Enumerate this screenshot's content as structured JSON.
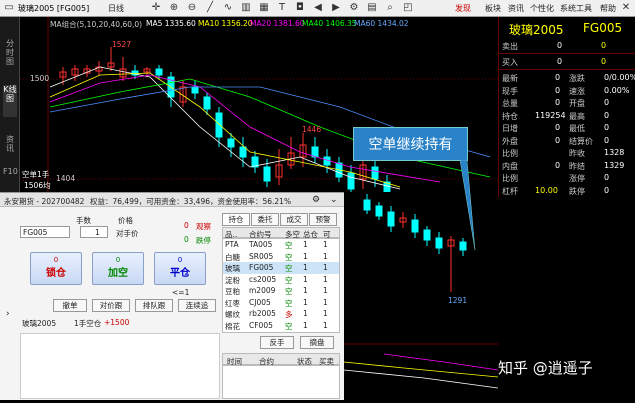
{
  "topbar": {
    "symbol": "玻璃2005 [FG005]",
    "period": "日线",
    "menu": [
      "发现",
      "板块",
      "资讯",
      "个性化",
      "系统工具",
      "帮助"
    ]
  },
  "lefttabs": [
    "分时图",
    "K线图",
    "资讯",
    "F10"
  ],
  "chart": {
    "ma_legend": {
      "title": "MA组合(5,10,20,40,60,0)",
      "ma5": "MA5 1335.60",
      "ma10": "MA10 1356.20",
      "ma20": "MA20 1381.60",
      "ma40": "MA40 1406.35",
      "ma60": "MA60 1434.02"
    },
    "high_label": "1527",
    "mid_label": "1446",
    "low_label": "1291",
    "axis_1500": "1500",
    "cross_price": "1404",
    "position_label": "空单1手",
    "position_price": "1506均",
    "colors": {
      "ma5": "#ffffff",
      "ma10": "#ffff00",
      "ma20": "#ff00ff",
      "ma40": "#00ff00",
      "ma60": "#4a90ff",
      "up": "#ff3030",
      "down": "#00ffff"
    }
  },
  "callout": "空单继续持有",
  "watermark": "知乎 @逍遥子",
  "quote": {
    "name": "玻璃2005",
    "code": "FG005",
    "sell": {
      "label": "卖出",
      "v1": "0",
      "v2": "0"
    },
    "buy": {
      "label": "买入",
      "v1": "0",
      "v2": "0"
    },
    "rows": [
      {
        "l1": "最新",
        "v1": "0",
        "l2": "涨跌",
        "v2": "0/0.00%"
      },
      {
        "l1": "现手",
        "v1": "0",
        "l2": "速涨",
        "v2": "0.00%"
      },
      {
        "l1": "总量",
        "v1": "0",
        "l2": "开盘",
        "v2": "0"
      },
      {
        "l1": "持仓",
        "v1": "119254",
        "l2": "最高",
        "v2": "0"
      },
      {
        "l1": "日增",
        "v1": "0",
        "l2": "最低",
        "v2": "0"
      },
      {
        "l1": "外盘",
        "v1": "0",
        "l2": "结算价",
        "v2": "0"
      },
      {
        "l1": "比例",
        "v1": "",
        "l2": "昨收",
        "v2": "1328"
      },
      {
        "l1": "内盘",
        "v1": "0",
        "l2": "昨结",
        "v2": "1329"
      },
      {
        "l1": "比例",
        "v1": "",
        "l2": "涨停",
        "v2": "0"
      },
      {
        "l1": "杠杆",
        "v1": "10.00",
        "l2": "跌停",
        "v2": "0"
      }
    ]
  },
  "trade": {
    "account": "永安期货 - 202700482",
    "equity": "权益：76,499，可用资金：33,496，资金使用率：56.21%",
    "contract_label": "手数",
    "price_label": "价格",
    "contract": "FG005",
    "qty": "1",
    "price_type": "对手价",
    "rate_label1": "0",
    "rate_label2": "0",
    "status1": "观察",
    "status2": "跌停",
    "btn_lock": {
      "top": "0",
      "label": "锁仓"
    },
    "btn_open": {
      "top": "0",
      "label": "加空"
    },
    "btn_close": {
      "top": "0",
      "label": "平仓",
      "sub": "<=1"
    },
    "small_btns": [
      "撤单",
      "对价跟",
      "排队跟",
      "连续追"
    ],
    "pos_line": {
      "name": "玻璃2005",
      "desc": "1手空仓",
      "pnl": "+1500"
    },
    "tabs": [
      "持仓",
      "委托",
      "成交",
      "预警"
    ],
    "table_headers": [
      "品..",
      "合约号",
      "多空",
      "总仓",
      "可"
    ],
    "table_rows": [
      [
        "PTA",
        "TA005",
        "空",
        "1",
        "1"
      ],
      [
        "白糖",
        "SR005",
        "空",
        "1",
        "1"
      ],
      [
        "玻璃",
        "FG005",
        "空",
        "1",
        "1"
      ],
      [
        "淀粉",
        "cs2005",
        "空",
        "1",
        "1"
      ],
      [
        "豆粕",
        "m2009",
        "空",
        "1",
        "1"
      ],
      [
        "红枣",
        "CJ005",
        "空",
        "1",
        "1"
      ],
      [
        "螺纹",
        "rb2005",
        "多",
        "1",
        "1"
      ],
      [
        "棉花",
        "CF005",
        "空",
        "1",
        "1"
      ]
    ],
    "bottom_btns": [
      "反手",
      "摘盘"
    ],
    "order_headers": [
      "时间",
      "合约",
      "状态",
      "买卖"
    ]
  }
}
